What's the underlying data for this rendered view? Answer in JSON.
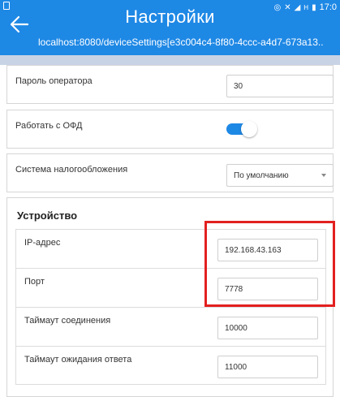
{
  "status_bar": {
    "time": "17:0",
    "icons": [
      "nfc-icon",
      "mute-icon",
      "signal-icon",
      "h-icon",
      "battery-icon"
    ],
    "network_letter": "H"
  },
  "header": {
    "title": "Настройки",
    "url": "localhost:8080/deviceSettings[e3c004c4-8f80-4ccc-a4d7-673a13..",
    "back_icon": "back-arrow-icon"
  },
  "settings": {
    "operator_password": {
      "label": "Пароль оператора",
      "value": "30"
    },
    "ofd": {
      "label": "Работать с ОФД",
      "enabled": true
    },
    "tax_system": {
      "label": "Система налогообложения",
      "value": "По умолчанию"
    }
  },
  "device": {
    "title": "Устройство",
    "ip": {
      "label": "IP-адрес",
      "value": "192.168.43.163"
    },
    "port": {
      "label": "Порт",
      "value": "7778"
    },
    "connect_timeout": {
      "label": "Таймаут соединения",
      "value": "10000"
    },
    "response_timeout": {
      "label": "Таймаут ожидания ответа",
      "value": "11000"
    }
  },
  "colors": {
    "primary": "#1e88e5",
    "highlight": "#e32020"
  }
}
